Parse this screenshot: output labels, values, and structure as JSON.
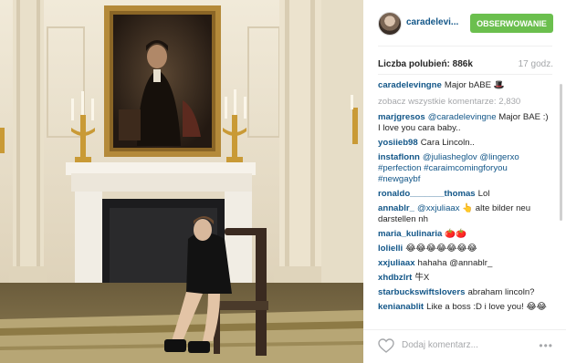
{
  "post": {
    "username": "caradelevi...",
    "follow_label": "OBSERWOWANIE",
    "likes_label": "Liczba polubień: 886k",
    "time_label": "17 godz.",
    "caption": {
      "user": "caradelevingne",
      "text": "Major bABE 🎩"
    },
    "view_all_label": "zobacz wszystkie komentarze: 2,830",
    "comments": [
      {
        "user": "marjgresos",
        "mention": "@caradelevingne",
        "text": " Major BAE :) I love you cara baby.."
      },
      {
        "user": "yosiieb98",
        "mention": "",
        "text": "Cara Lincoln.."
      },
      {
        "user": "instaflonn",
        "mention": "@juliasheglov @lingerxo #perfection #caraimcomingforyou #newgaybf",
        "text": ""
      },
      {
        "user": "ronaldo_______thomas",
        "mention": "",
        "text": "Lol"
      },
      {
        "user": "annablr_",
        "mention": "@xxjuliaax",
        "text": " 👆 alte bilder neu darstellen nh"
      },
      {
        "user": "maria_kulinaria",
        "mention": "",
        "text": "🍅🍅"
      },
      {
        "user": "lolielli",
        "mention": "",
        "text": "😂😂😂😂😂😂😂"
      },
      {
        "user": "xxjuliaax",
        "mention": "",
        "text": "hahaha @annablr_"
      },
      {
        "user": "xhdbzlrt",
        "mention": "",
        "text": "牛X"
      },
      {
        "user": "starbuckswiftslovers",
        "mention": "",
        "text": "abraham lincoln?"
      },
      {
        "user": "kenianablit",
        "mention": "",
        "text": "Like a boss :D i love you! 😂😂"
      }
    ],
    "add_comment_placeholder": "Dodaj komentarz...",
    "more_label": "•••"
  },
  "icons": {
    "heart": "heart-outline-icon",
    "more": "ellipsis-icon"
  },
  "colors": {
    "username_blue": "#125688",
    "follow_green": "#6bbf4e",
    "muted_gray": "#a5a7aa"
  }
}
